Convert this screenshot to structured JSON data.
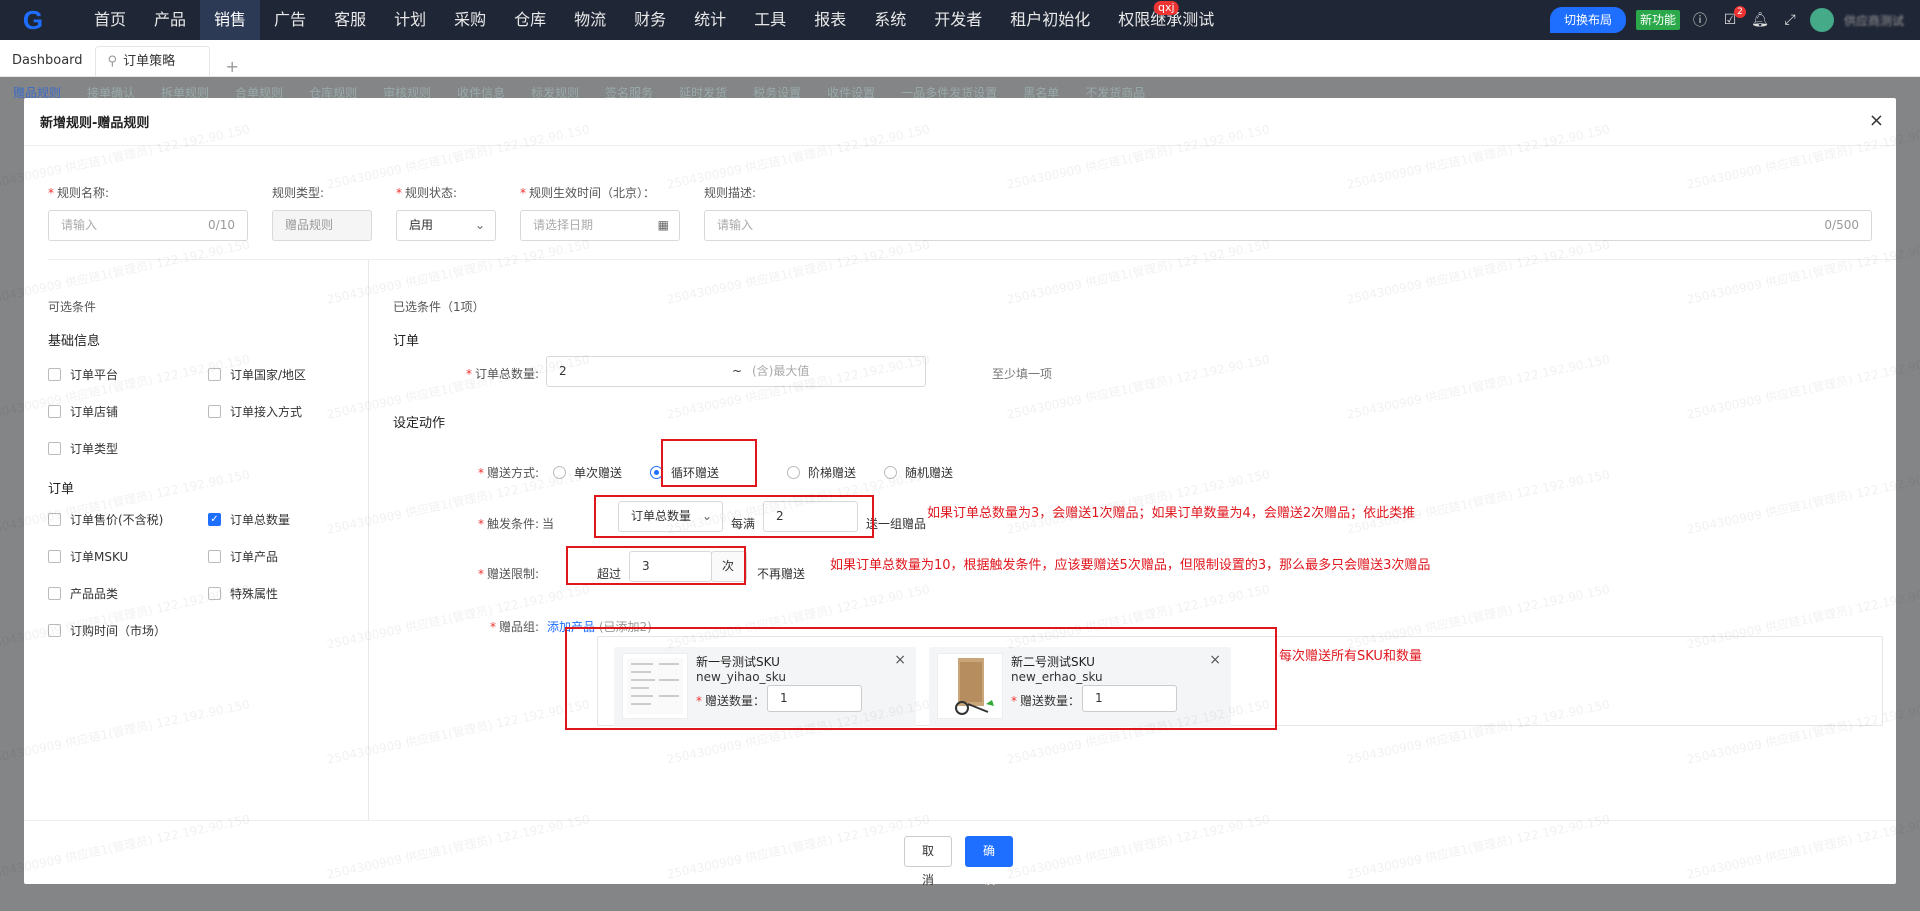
{
  "topnav": {
    "logo": "G",
    "items": [
      "首页",
      "产品",
      "销售",
      "广告",
      "客服",
      "计划",
      "采购",
      "仓库",
      "物流",
      "财务",
      "统计",
      "工具",
      "报表",
      "系统",
      "开发者",
      "租户初始化",
      "权限继承测试"
    ],
    "active_index": 2,
    "user_badge": "qxj",
    "switch_layout": "切换布局",
    "new_feature": "新功能",
    "task_badge": "2",
    "username": "供应商测试"
  },
  "tabs": {
    "dashboard": "Dashboard",
    "current": "订单策略",
    "plus": "+"
  },
  "subtabs": [
    "赠品规则",
    "接单确认",
    "拆单规则",
    "合单规则",
    "仓库规则",
    "审核规则",
    "收件信息",
    "标发规则",
    "签名服务",
    "延时发货",
    "税务设置",
    "收件设置",
    "一品多件发货设置",
    "黑名单",
    "不发货商品"
  ],
  "modal": {
    "title": "新增规则-赠品规则",
    "close": "×",
    "fields": {
      "name_label": "规则名称:",
      "name_placeholder": "请输入",
      "name_count": "0/10",
      "type_label": "规则类型:",
      "type_value": "赠品规则",
      "status_label": "规则状态:",
      "status_value": "启用",
      "time_label": "规则生效时间（北京）：",
      "time_placeholder": "请选择日期",
      "desc_label": "规则描述:",
      "desc_placeholder": "请输入",
      "desc_count": "0/500"
    },
    "left": {
      "title": "可选条件",
      "group1": "基础信息",
      "group1_items": [
        "订单平台",
        "订单国家/地区",
        "订单店铺",
        "订单接入方式",
        "订单类型"
      ],
      "group2": "订单",
      "group2_items": [
        "订单售价(不含税)",
        "订单总数量",
        "订单MSKU",
        "订单产品",
        "产品品类",
        "特殊属性",
        "订购时间（市场）"
      ]
    },
    "right": {
      "selected_title": "已选条件（1项）",
      "section_order": "订单",
      "qty_label": "订单总数量:",
      "qty_min": "2",
      "qty_tilde": "~",
      "qty_max_placeholder": "(含)最大值",
      "qty_hint": "至少填一项",
      "section_action": "设定动作",
      "gift_mode_label": "赠送方式:",
      "gift_modes": [
        "单次赠送",
        "循环赠送",
        "阶梯赠送",
        "随机赠送"
      ],
      "gift_mode_selected": 1,
      "trigger_label": "触发条件:",
      "trigger_when": "当",
      "trigger_select": "订单总数量",
      "trigger_every": "每满",
      "trigger_value": "2",
      "trigger_suffix": "送一组赠品",
      "limit_label": "赠送限制:",
      "limit_over": "超过",
      "limit_value": "3",
      "limit_unit": "次",
      "limit_suffix": "不再赠送",
      "group_label": "赠品组:",
      "group_add": "添加产品",
      "group_count": "(已添加2)",
      "skus": [
        {
          "name": "新一号测试SKU",
          "code": "new_yihao_sku",
          "qty_label": "赠送数量：",
          "qty": "1"
        },
        {
          "name": "新二号测试SKU",
          "code": "new_erhao_sku",
          "qty_label": "赠送数量：",
          "qty": "1"
        }
      ]
    },
    "notes": {
      "trigger_note": "如果订单总数量为3，会赠送1次赠品；如果订单数量为4，会赠送2次赠品；依此类推",
      "limit_note": "如果订单总数量为10，根据触发条件，应该要赠送5次赠品，但限制设置的3，那么最多只会赠送3次赠品",
      "group_note": "每次赠送所有SKU和数量"
    },
    "footer": {
      "cancel": "取消",
      "ok": "确认"
    }
  },
  "watermark": "2504300909 供应链1(管理员) 122.192.90.150"
}
